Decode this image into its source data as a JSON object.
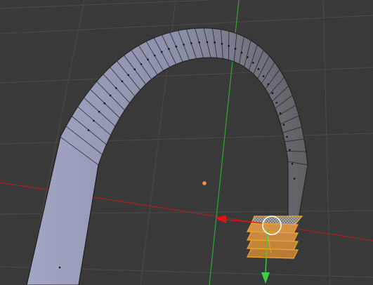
{
  "viewport": {
    "background": "#393939",
    "grid_color": "#4a4a4a",
    "x_axis_color": "#b01e1e",
    "y_axis_color": "#2fa82f"
  },
  "object": {
    "face_light": "#9699b4",
    "face_dark": "#6e6f72",
    "edge_color": "#1e1e1e",
    "selection_color": "#f5a623",
    "selection_fill": "#cf8a3a"
  },
  "gizmo": {
    "x_arrow_color": "#e01414",
    "y_arrow_color": "#3fcf3f",
    "pivot_ring_color": "#ffffff",
    "origin_color": "#e8935a"
  },
  "icons": {
    "transform_x": "red-arrow-left-icon",
    "transform_y": "green-arrow-down-icon",
    "pivot": "white-circle-icon",
    "origin": "origin-dot-icon"
  }
}
